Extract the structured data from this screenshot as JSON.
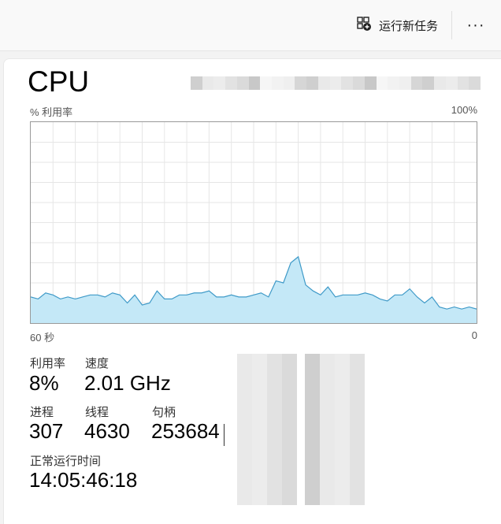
{
  "topbar": {
    "run_task_label": "运行新任务",
    "run_task_icon": "new-task-icon",
    "more_label": "···",
    "more_icon": "more-options-icon"
  },
  "panel": {
    "title": "CPU",
    "chart": {
      "y_label": "% 利用率",
      "y_max_label": "100%",
      "x_left_label": "60 秒",
      "x_right_label": "0",
      "line_color": "#3f9ac8",
      "fill_color": "#c4e8f7",
      "grid_color": "#e6e6e6"
    },
    "stats": {
      "utilization_label": "利用率",
      "utilization_value": "8%",
      "speed_label": "速度",
      "speed_value": "2.01 GHz",
      "processes_label": "进程",
      "processes_value": "307",
      "threads_label": "线程",
      "threads_value": "4630",
      "handles_label": "句柄",
      "handles_value": "253684",
      "uptime_label": "正常运行时间",
      "uptime_value": "14:05:46:18"
    }
  },
  "chart_data": {
    "type": "area",
    "title": "CPU",
    "xlabel": "60 秒",
    "ylabel": "% 利用率",
    "xlim": [
      60,
      0
    ],
    "ylim": [
      0,
      100
    ],
    "grid": true,
    "x": [
      60,
      59,
      58,
      57,
      56,
      55,
      54,
      53,
      52,
      51,
      50,
      49,
      48,
      47,
      46,
      45,
      44,
      43,
      42,
      41,
      40,
      39,
      38,
      37,
      36,
      35,
      34,
      33,
      32,
      31,
      30,
      29,
      28,
      27,
      26,
      25,
      24,
      23,
      22,
      21,
      20,
      19,
      18,
      17,
      16,
      15,
      14,
      13,
      12,
      11,
      10,
      9,
      8,
      7,
      6,
      5,
      4,
      3,
      2,
      1,
      0
    ],
    "series": [
      {
        "values": [
          13,
          12,
          15,
          14,
          12,
          13,
          12,
          13,
          14,
          14,
          13,
          15,
          14,
          10,
          14,
          9,
          10,
          16,
          12,
          12,
          14,
          14,
          15,
          15,
          16,
          13,
          13,
          14,
          13,
          13,
          14,
          15,
          13,
          21,
          20,
          30,
          33,
          19,
          16,
          14,
          18,
          13,
          14,
          14,
          14,
          15,
          14,
          12,
          11,
          14,
          14,
          17,
          13,
          10,
          13,
          8,
          7,
          8,
          7,
          8,
          7
        ]
      }
    ]
  }
}
